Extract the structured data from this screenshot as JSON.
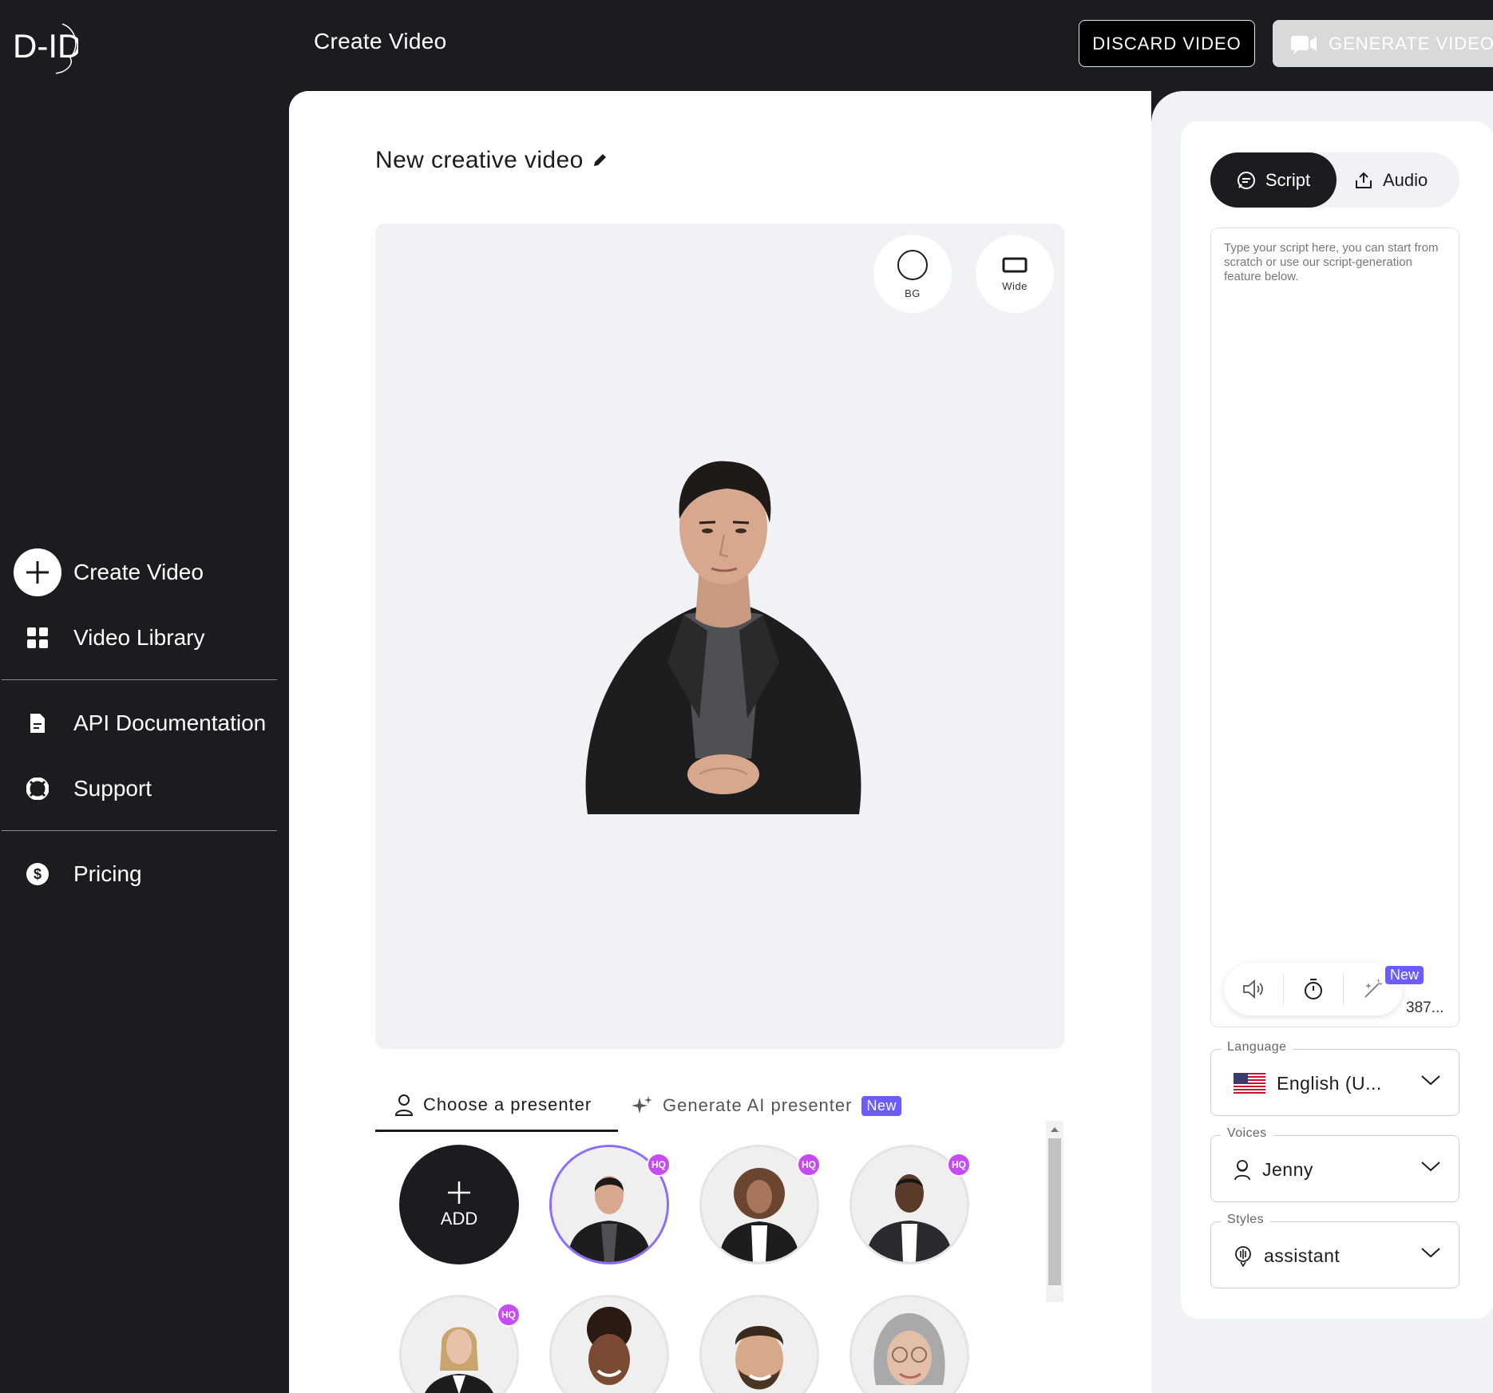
{
  "header": {
    "logo_text": "D-ID",
    "title": "Create Video",
    "discard_label": "DISCARD VIDEO",
    "generate_label": "GENERATE VIDEO"
  },
  "sidebar": {
    "items": [
      {
        "label": "Create Video",
        "icon": "plus-icon"
      },
      {
        "label": "Video Library",
        "icon": "grid-icon"
      },
      {
        "label": "API Documentation",
        "icon": "document-icon"
      },
      {
        "label": "Support",
        "icon": "lifebuoy-icon"
      },
      {
        "label": "Pricing",
        "icon": "dollar-icon"
      }
    ]
  },
  "editor": {
    "video_title": "New creative video",
    "canvas_controls": [
      {
        "label": "BG",
        "icon": "circle-icon"
      },
      {
        "label": "Wide",
        "icon": "rectangle-icon"
      }
    ],
    "tabs": {
      "presenter": "Choose a presenter",
      "ai": "Generate AI presenter",
      "ai_badge": "New"
    },
    "gallery": {
      "add_label": "ADD",
      "hq_label": "HQ"
    }
  },
  "script_panel": {
    "tab_script": "Script",
    "tab_audio": "Audio",
    "placeholder": "Type your script here, you can start from scratch or use our script-generation feature below.",
    "tool_badge": "New",
    "char_count": "387...",
    "language": {
      "label": "Language",
      "value": "English (U..."
    },
    "voices": {
      "label": "Voices",
      "value": "Jenny"
    },
    "styles": {
      "label": "Styles",
      "value": "assistant"
    }
  },
  "colors": {
    "dark": "#1b1c1f",
    "accent_purple": "#6a5cff",
    "hq_pink": "#c64cf2",
    "panel_bg": "#f1f2f5"
  }
}
